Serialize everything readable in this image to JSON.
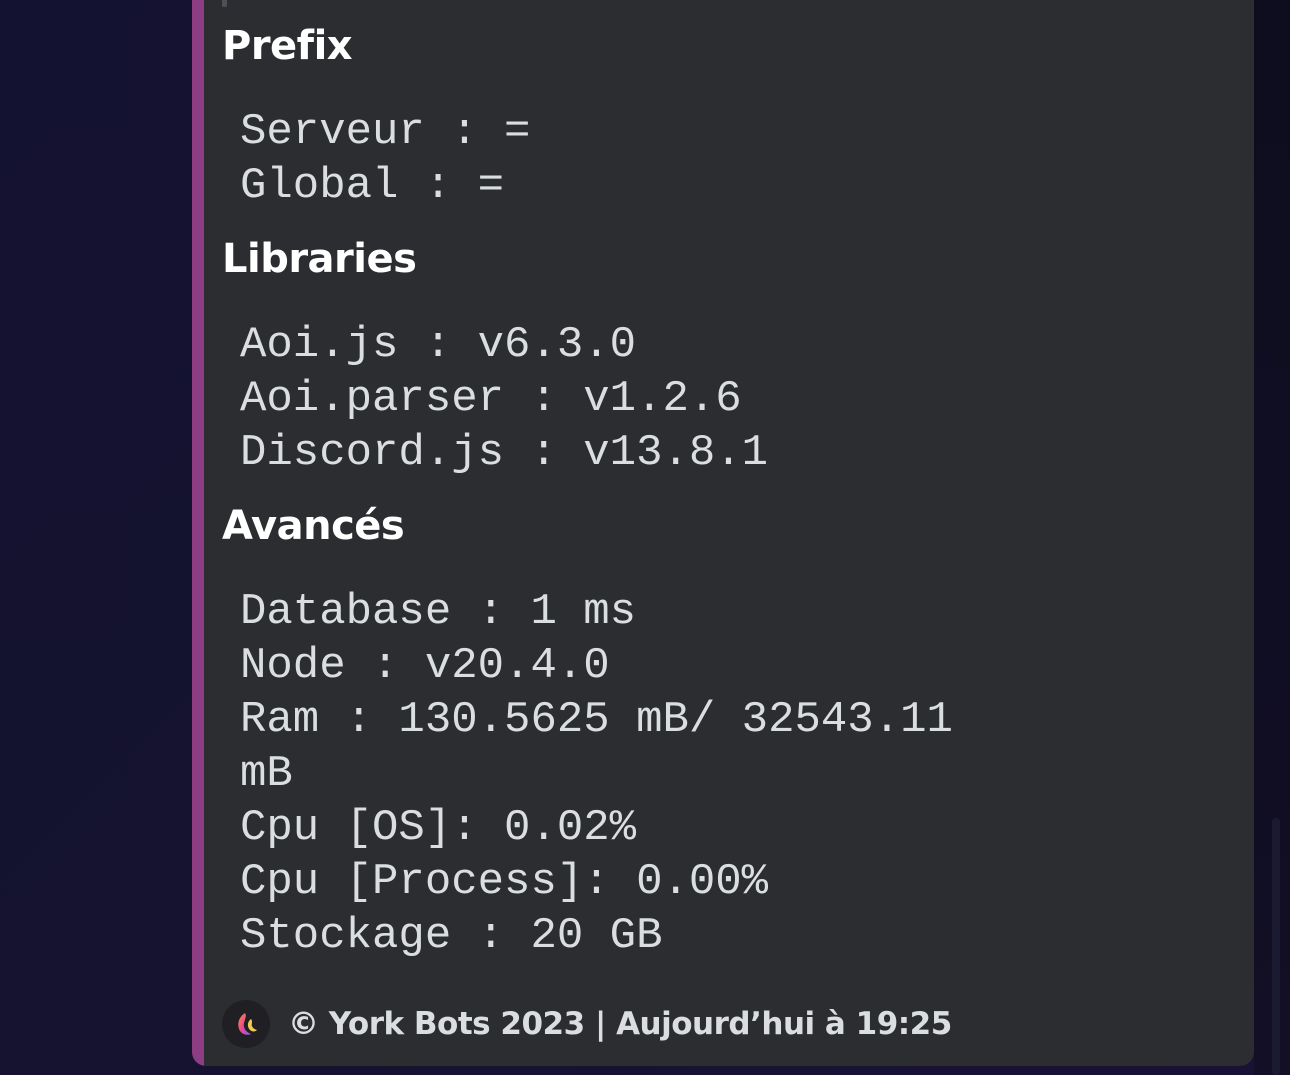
{
  "embed": {
    "accent_color": "#8c3d84",
    "sections": {
      "prefix": {
        "title": "Prefix",
        "lines": [
          "Serveur : =",
          "Global : ="
        ]
      },
      "libraries": {
        "title": "Libraries",
        "lines": [
          "Aoi.js : v6.3.0",
          "Aoi.parser : v1.2.6",
          "Discord.js : v13.8.1"
        ]
      },
      "advanced": {
        "title": "Avancés",
        "lines": [
          "Database : 1 ms",
          "Node : v20.4.0",
          "Ram : 130.5625 mB/ 32543.11",
          "mB",
          "Cpu [OS]: 0.02%",
          "Cpu [Process]: 0.00%",
          "Stockage : 20 GB"
        ]
      }
    },
    "footer": {
      "icon": "york-bots-logo-icon",
      "text": "© York Bots 2023 | Aujourd’hui à 19:25"
    }
  }
}
